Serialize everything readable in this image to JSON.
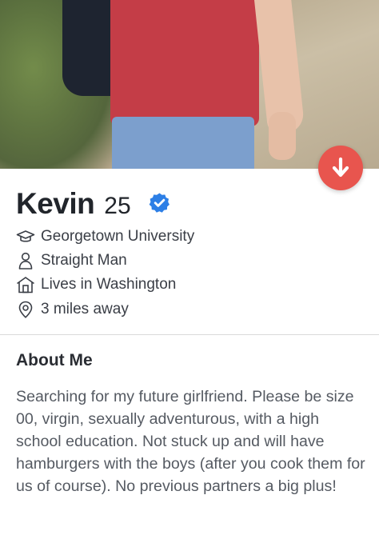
{
  "profile": {
    "name": "Kevin",
    "age": "25",
    "verified": true,
    "details": [
      {
        "icon": "graduation-cap-icon",
        "text": "Georgetown University"
      },
      {
        "icon": "person-icon",
        "text": "Straight Man"
      },
      {
        "icon": "house-icon",
        "text": "Lives in Washington"
      },
      {
        "icon": "location-pin-icon",
        "text": "3 miles away"
      }
    ]
  },
  "about": {
    "heading": "About Me",
    "text": "Searching for my future girlfriend. Please be size 00, virgin, sexually adventurous, with a high school education. Not stuck up and will have hamburgers with the boys (after you cook them for us of course). No previous partners a big plus!"
  },
  "colors": {
    "action_button": "#e8554e",
    "verified_badge": "#2d7fe6"
  },
  "photo": {
    "alt_icon": "profile-photo"
  }
}
